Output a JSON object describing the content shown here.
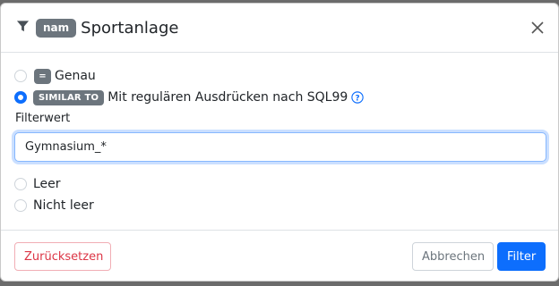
{
  "header": {
    "badge": "nam",
    "title": "Sportanlage"
  },
  "options": {
    "exact": {
      "badge": "=",
      "label": "Genau",
      "checked": false
    },
    "similar": {
      "badge": "SIMILAR TO",
      "label": "Mit regulären Ausdrücken nach SQL99",
      "checked": true
    },
    "empty": {
      "label": "Leer",
      "checked": false
    },
    "not_empty": {
      "label": "Nicht leer",
      "checked": false
    }
  },
  "filter_value": {
    "label": "Filterwert",
    "value": "Gymnasium_*"
  },
  "footer": {
    "reset_label": "Zurücksetzen",
    "cancel_label": "Abbrechen",
    "filter_label": "Filter"
  },
  "icons": {
    "filter": "filter-icon",
    "close": "close-icon",
    "help": "question-circle-icon"
  },
  "colors": {
    "primary": "#0d6efd",
    "danger": "#dc3545",
    "badge": "#6c757d"
  }
}
